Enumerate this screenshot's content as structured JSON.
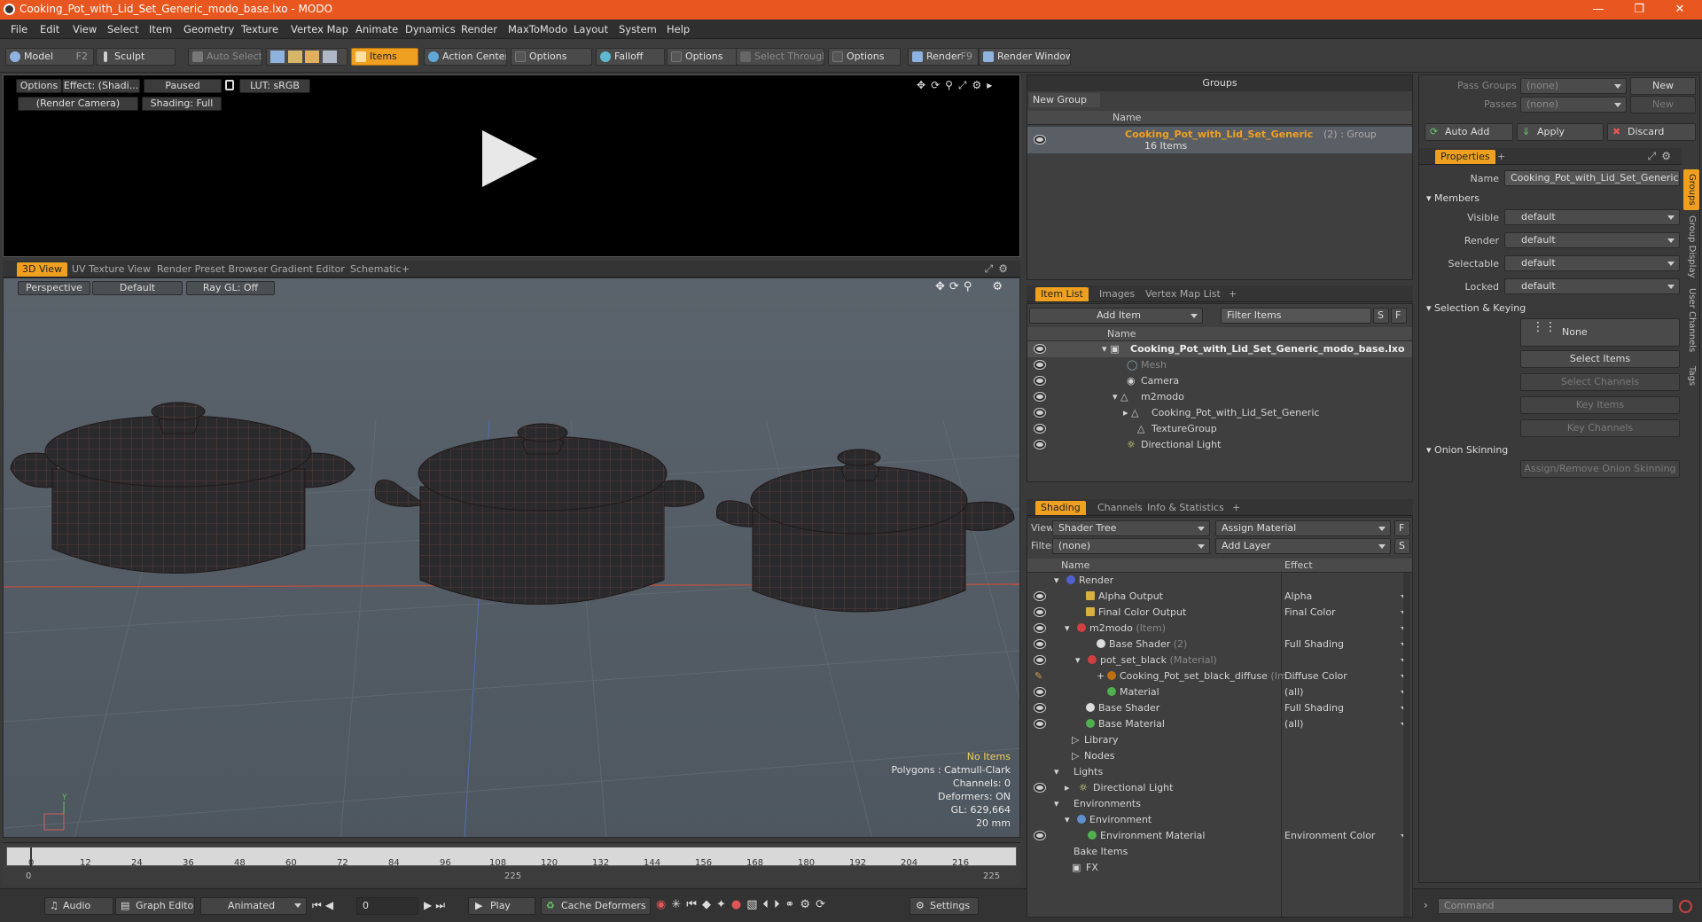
{
  "window": {
    "title": "Cooking_Pot_with_Lid_Set_Generic_modo_base.lxo - MODO"
  },
  "menu": [
    "File",
    "Edit",
    "View",
    "Select",
    "Item",
    "Geometry",
    "Texture",
    "Vertex Map",
    "Animate",
    "Dynamics",
    "Render",
    "MaxToModo",
    "Layout",
    "System",
    "Help"
  ],
  "toolbar": {
    "model": "Model",
    "model_key": "F2",
    "sculpt": "Sculpt",
    "auto_select": "Auto Select",
    "items": "Items",
    "action_center": "Action Center",
    "options1": "Options",
    "falloff": "Falloff",
    "options2": "Options",
    "select_through": "Select Through",
    "options3": "Options",
    "render": "Render",
    "render_key": "F9",
    "render_window": "Render Window"
  },
  "preview": {
    "options": "Options",
    "effect": "Effect: (Shadi...",
    "paused": "Paused",
    "lut": "LUT: sRGB",
    "camera": "(Render Camera)",
    "shading": "Shading: Full"
  },
  "viewport_tabs": [
    "3D View",
    "UV Texture View",
    "Render Preset Browser",
    "Gradient Editor",
    "Schematic",
    "+"
  ],
  "viewport": {
    "perspective": "Perspective",
    "default": "Default",
    "raygl": "Ray GL: Off",
    "info": {
      "no_items": "No Items",
      "polygons": "Polygons : Catmull-Clark",
      "channels": "Channels: 0",
      "deformers": "Deformers: ON",
      "gl": "GL: 629,664",
      "scale": "20 mm"
    },
    "axis_label": "Y"
  },
  "timeline": {
    "ticks": [
      "0",
      "12",
      "24",
      "36",
      "48",
      "60",
      "72",
      "84",
      "96",
      "108",
      "120",
      "132",
      "144",
      "156",
      "168",
      "180",
      "192",
      "204",
      "216"
    ],
    "lower_left": "0",
    "lower_mid": "225",
    "lower_right": "225"
  },
  "bottombar": {
    "audio": "Audio",
    "graph_editor": "Graph Editor",
    "animated": "Animated",
    "frame": "0",
    "play": "Play",
    "cache_deformers": "Cache Deformers",
    "settings": "Settings"
  },
  "groups": {
    "title": "Groups",
    "new_group": "New Group",
    "col_name": "Name",
    "item_name": "Cooking_Pot_with_Lid_Set_Generic",
    "item_suffix": "(2) : Group",
    "item_count": "16 Items"
  },
  "itemlist": {
    "tabs": [
      "Item List",
      "Images",
      "Vertex Map List",
      "+"
    ],
    "add_item": "Add Item",
    "filter_items": "Filter Items",
    "s": "S",
    "f": "F",
    "col_name": "Name",
    "rows": [
      {
        "label": "Cooking_Pot_with_Lid_Set_Generic_modo_base.lxo"
      },
      {
        "label": "Mesh"
      },
      {
        "label": "Camera"
      },
      {
        "label": "m2modo"
      },
      {
        "label": "Cooking_Pot_with_Lid_Set_Generic"
      },
      {
        "label": "TextureGroup"
      },
      {
        "label": "Directional Light"
      }
    ]
  },
  "shading": {
    "tabs": [
      "Shading",
      "Channels",
      "Info & Statistics",
      "+"
    ],
    "view_label": "View",
    "view_value": "Shader Tree",
    "assign_material": "Assign Material",
    "f": "F",
    "filter_label": "Filter",
    "filter_value": "(none)",
    "add_layer": "Add Layer",
    "s": "S",
    "col_name": "Name",
    "col_effect": "Effect",
    "rows": [
      {
        "name": "Render",
        "sub": "",
        "effect": ""
      },
      {
        "name": "Alpha Output",
        "sub": "",
        "effect": "Alpha"
      },
      {
        "name": "Final Color Output",
        "sub": "",
        "effect": "Final Color"
      },
      {
        "name": "m2modo",
        "sub": "(Item)",
        "effect": ""
      },
      {
        "name": "Base Shader",
        "sub": "(2)",
        "effect": "Full Shading"
      },
      {
        "name": "pot_set_black",
        "sub": "(Material)",
        "effect": ""
      },
      {
        "name": "Cooking_Pot_set_black_diffuse",
        "sub": "(Im...",
        "effect": "Diffuse Color"
      },
      {
        "name": "Material",
        "sub": "",
        "effect": "(all)"
      },
      {
        "name": "Base Shader",
        "sub": "",
        "effect": "Full Shading"
      },
      {
        "name": "Base Material",
        "sub": "",
        "effect": "(all)"
      },
      {
        "name": "Library",
        "sub": "",
        "effect": ""
      },
      {
        "name": "Nodes",
        "sub": "",
        "effect": ""
      },
      {
        "name": "Lights",
        "sub": "",
        "effect": ""
      },
      {
        "name": "Directional Light",
        "sub": "",
        "effect": ""
      },
      {
        "name": "Environments",
        "sub": "",
        "effect": ""
      },
      {
        "name": "Environment",
        "sub": "",
        "effect": ""
      },
      {
        "name": "Environment Material",
        "sub": "",
        "effect": "Environment Color"
      },
      {
        "name": "Bake Items",
        "sub": "",
        "effect": ""
      },
      {
        "name": "FX",
        "sub": "",
        "effect": ""
      }
    ]
  },
  "properties": {
    "pass_groups_label": "Pass Groups",
    "pass_groups_value": "(none)",
    "new1": "New",
    "passes_label": "Passes",
    "passes_value": "(none)",
    "new2": "New",
    "auto_add": "Auto Add",
    "apply": "Apply",
    "discard": "Discard",
    "tab": "Properties",
    "plus": "+",
    "name_label": "Name",
    "name_value": "Cooking_Pot_with_Lid_Set_Generic",
    "members": "Members",
    "visible_label": "Visible",
    "visible_value": "default",
    "render_label": "Render",
    "render_value": "default",
    "selectable_label": "Selectable",
    "selectable_value": "default",
    "locked_label": "Locked",
    "locked_value": "default",
    "sel_keying": "Selection & Keying",
    "none": "None",
    "select_items": "Select Items",
    "select_channels": "Select Channels",
    "key_items": "Key Items",
    "key_channels": "Key Channels",
    "onion": "Onion Skinning",
    "assign_onion": "Assign/Remove Onion Skinning",
    "vtabs": [
      "Groups",
      "Group Display",
      "User Channels",
      "Tags"
    ],
    "command_placeholder": "Command"
  },
  "colors": {
    "accent": "#f0a020",
    "titlebar": "#e8571f"
  }
}
